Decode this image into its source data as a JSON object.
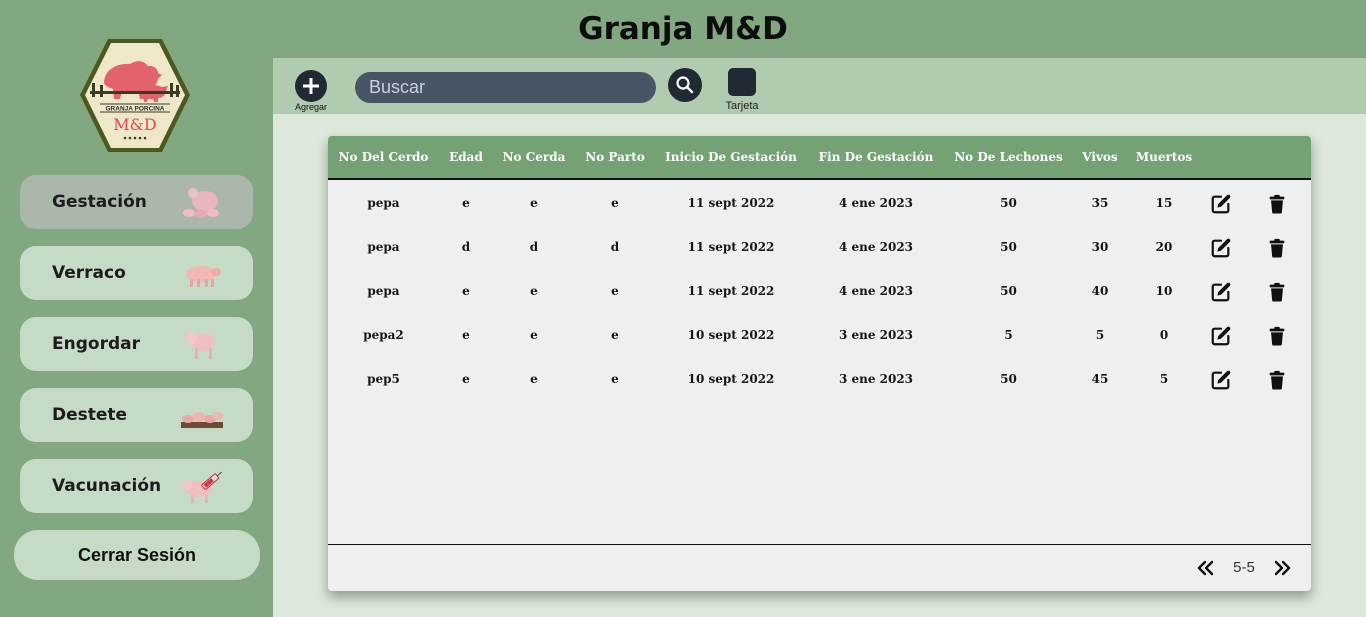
{
  "app": {
    "title": "Granja M&D"
  },
  "logo": {
    "top_text": "GRANJA PORCINA",
    "mark": "M&D"
  },
  "sidebar": {
    "items": [
      {
        "label": "Gestación",
        "active": true,
        "icon": "sow-with-piglets"
      },
      {
        "label": "Verraco",
        "active": false,
        "icon": "boar"
      },
      {
        "label": "Engordar",
        "active": false,
        "icon": "pig"
      },
      {
        "label": "Destete",
        "active": false,
        "icon": "piglets-group"
      },
      {
        "label": "Vacunación",
        "active": false,
        "icon": "pig-syringe"
      }
    ],
    "logout_label": "Cerrar Sesión"
  },
  "toolbar": {
    "add_label": "Agregar",
    "search_placeholder": "Buscar",
    "card_label": "Tarjeta"
  },
  "table": {
    "columns": [
      "No Del Cerdo",
      "Edad",
      "No Cerda",
      "No Parto",
      "Inicio De Gestación",
      "Fin De Gestación",
      "No De Lechones",
      "Vivos",
      "Muertos"
    ],
    "rows": [
      [
        "pepa",
        "e",
        "e",
        "e",
        "11 sept 2022",
        "4 ene 2023",
        "50",
        "35",
        "15"
      ],
      [
        "pepa",
        "d",
        "d",
        "d",
        "11 sept 2022",
        "4 ene 2023",
        "50",
        "30",
        "20"
      ],
      [
        "pepa",
        "e",
        "e",
        "e",
        "11 sept 2022",
        "4 ene 2023",
        "50",
        "40",
        "10"
      ],
      [
        "pepa2",
        "e",
        "e",
        "e",
        "10 sept 2022",
        "3 ene 2023",
        "5",
        "5",
        "0"
      ],
      [
        "pep5",
        "e",
        "e",
        "e",
        "10 sept 2022",
        "3 ene 2023",
        "50",
        "45",
        "5"
      ]
    ]
  },
  "pagination": {
    "text": "5-5"
  },
  "colors": {
    "sidebar_bg": "#82a882",
    "header_row": "#75a275",
    "toolbar_bg": "#b0cbb0",
    "dark_button": "#1f2a33"
  }
}
